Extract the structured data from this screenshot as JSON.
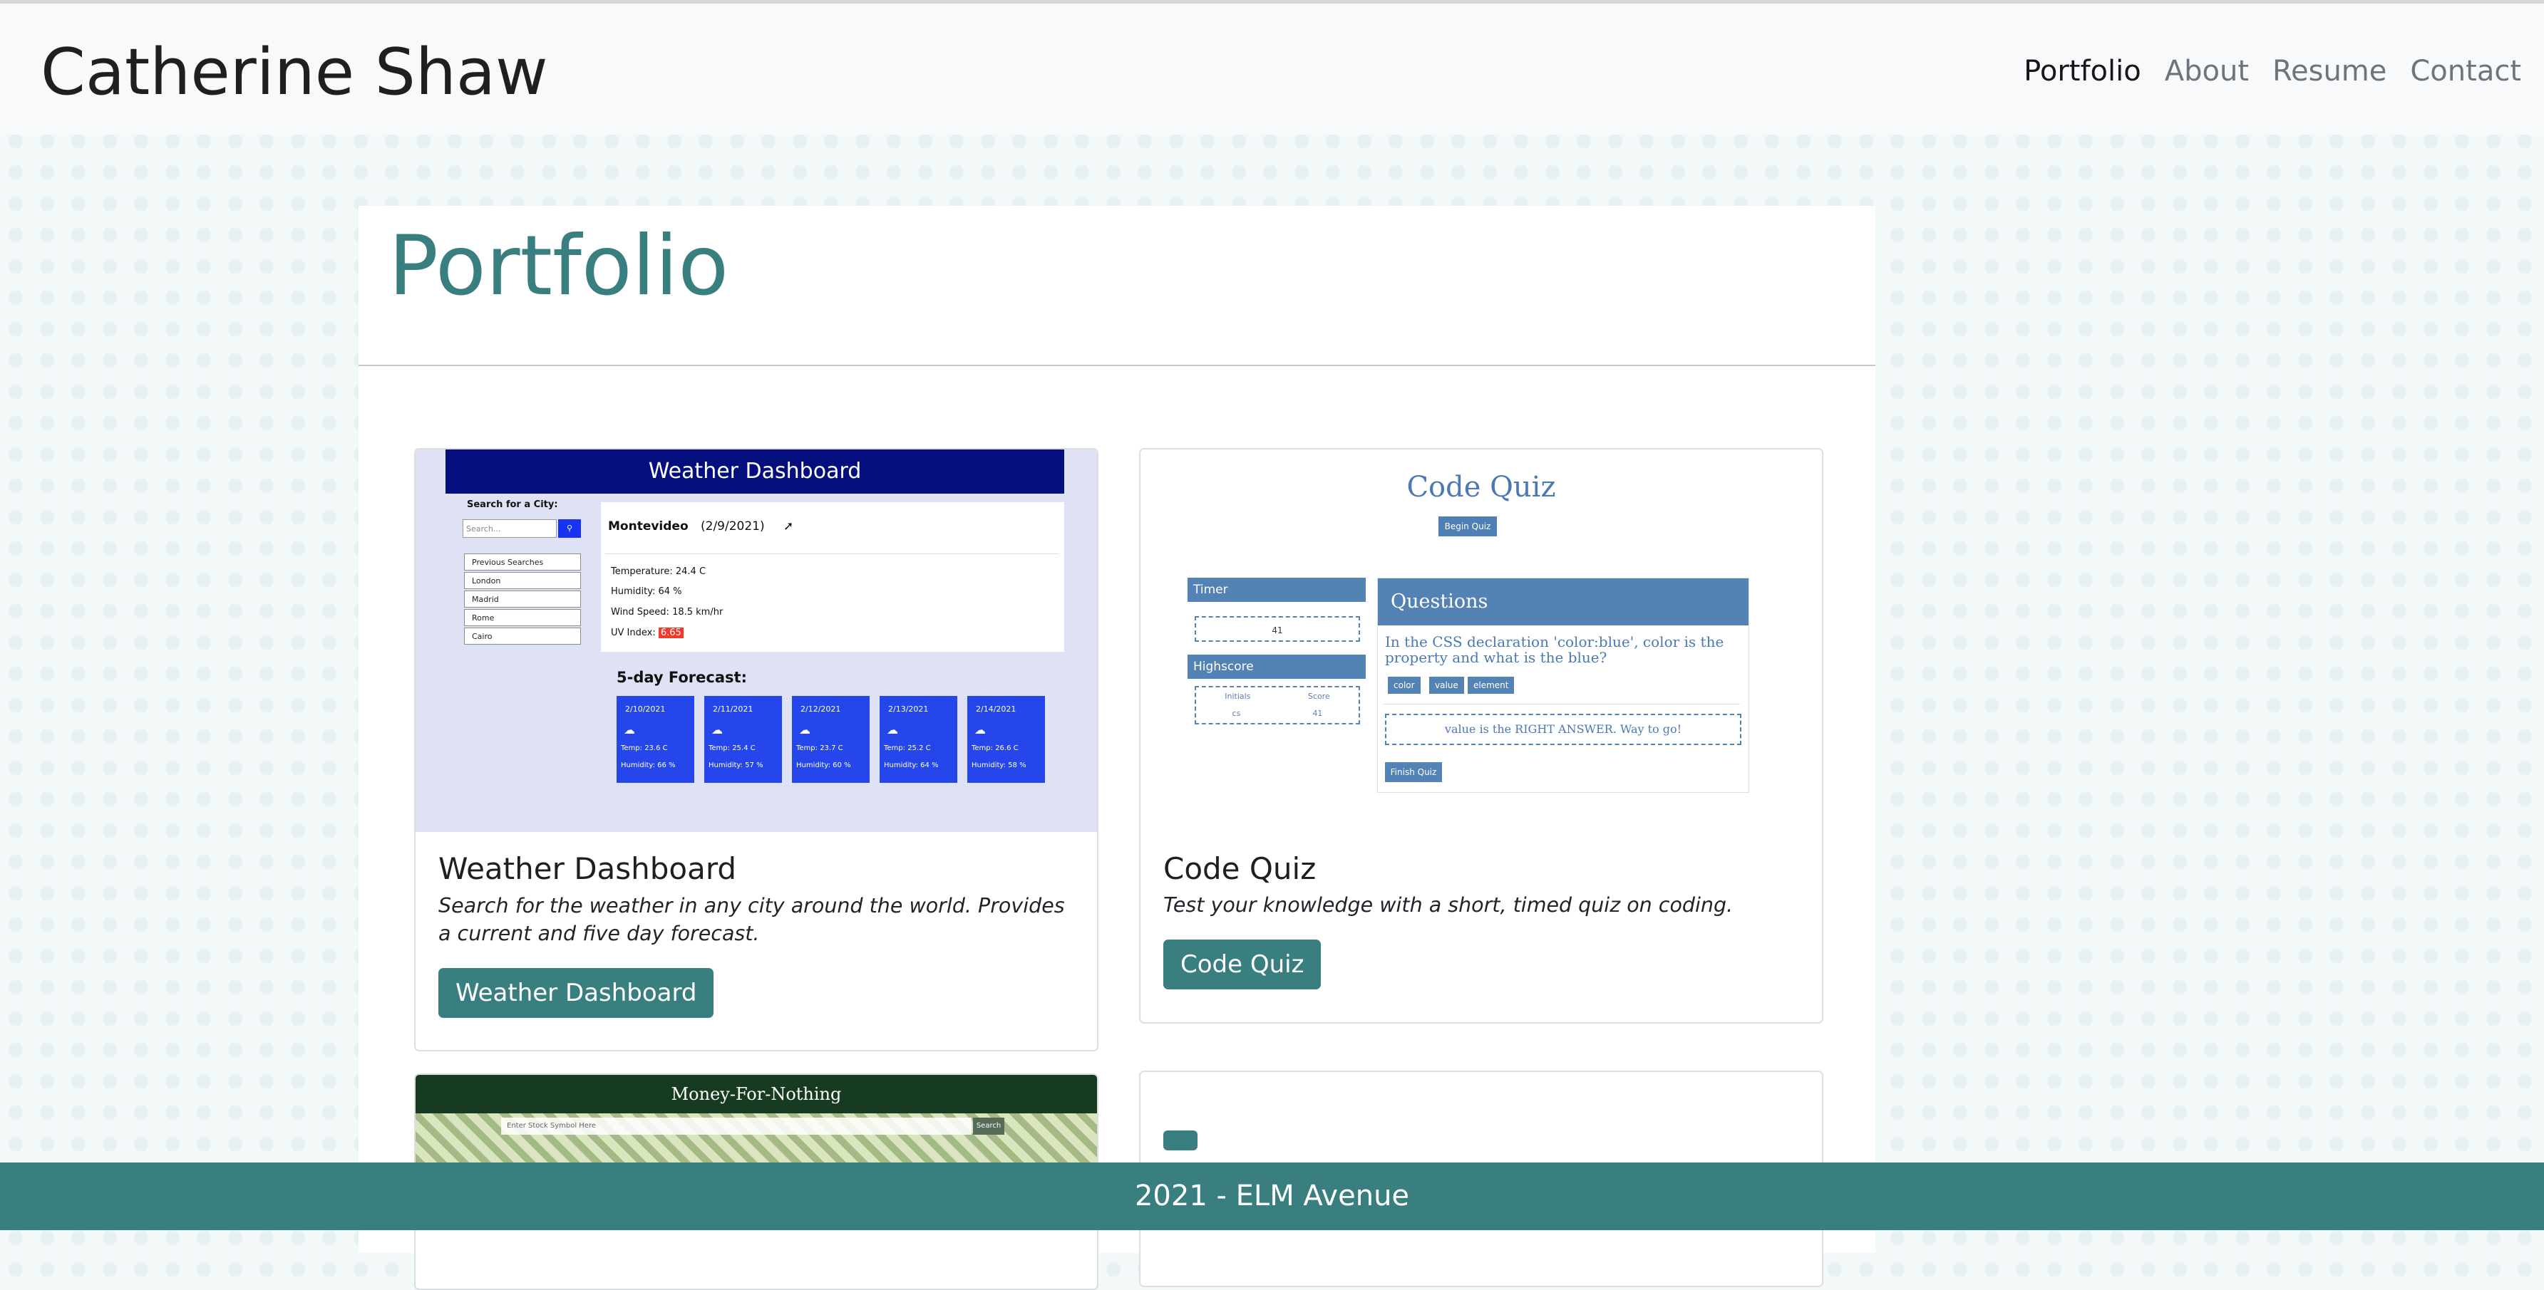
{
  "nav": {
    "brand": "Catherine Shaw",
    "links": [
      "Portfolio",
      "About",
      "Resume",
      "Contact"
    ]
  },
  "page": {
    "title": "Portfolio"
  },
  "projects": [
    {
      "title": "Weather Dashboard",
      "description": "Search for the weather in any city around the world. Provides a current and five day forecast.",
      "button": "Weather Dashboard",
      "preview": {
        "header": "Weather Dashboard",
        "search_label": "Search for a City:",
        "search_placeholder": "Search...",
        "search_icon": "search-icon",
        "previous_searches": [
          "Previous Searches",
          "London",
          "Madrid",
          "Rome",
          "Cairo"
        ],
        "city": "Montevideo",
        "date": "(2/9/2021)",
        "temperature": "Temperature: 24.4 C",
        "humidity": "Humidity: 64 %",
        "wind": "Wind Speed: 18.5 km/hr",
        "uv_label": "UV Index:",
        "uv_value": "6.65",
        "forecast_title": "5-day Forecast:",
        "forecast": [
          {
            "date": "2/10/2021",
            "temp": "Temp: 23.6 C",
            "humidity": "Humidity: 66 %"
          },
          {
            "date": "2/11/2021",
            "temp": "Temp: 25.4 C",
            "humidity": "Humidity: 57 %"
          },
          {
            "date": "2/12/2021",
            "temp": "Temp: 23.7 C",
            "humidity": "Humidity: 60 %"
          },
          {
            "date": "2/13/2021",
            "temp": "Temp: 25.2 C",
            "humidity": "Humidity: 64 %"
          },
          {
            "date": "2/14/2021",
            "temp": "Temp: 26.6 C",
            "humidity": "Humidity: 58 %"
          }
        ]
      }
    },
    {
      "title": "Code Quiz",
      "description": "Test your knowledge with a short, timed quiz on coding.",
      "button": "Code Quiz",
      "preview": {
        "title": "Code Quiz",
        "begin": "Begin Quiz",
        "timer_label": "Timer",
        "timer_value": "41",
        "highscore_label": "Highscore",
        "hs_cols": [
          "Initials",
          "Score"
        ],
        "hs_row": [
          "cs",
          "41"
        ],
        "questions_label": "Questions",
        "question": "In the CSS declaration 'color:blue', color is the property and what is the blue?",
        "options": [
          "color",
          "value",
          "element"
        ],
        "answer": "value is the RIGHT ANSWER. Way to go!",
        "finish": "Finish Quiz"
      }
    },
    {
      "preview": {
        "header": "Money-For-Nothing",
        "search_placeholder": "Enter Stock Symbol Here",
        "search_button": "Search"
      }
    },
    {
      "button": ""
    }
  ],
  "footer": {
    "text": "2021 - ELM Avenue"
  },
  "colors": {
    "accent": "#3a7f80",
    "navbar": "#f8f9fa",
    "quiz_blue": "#5382b4",
    "weather_navy": "#040e7d"
  }
}
